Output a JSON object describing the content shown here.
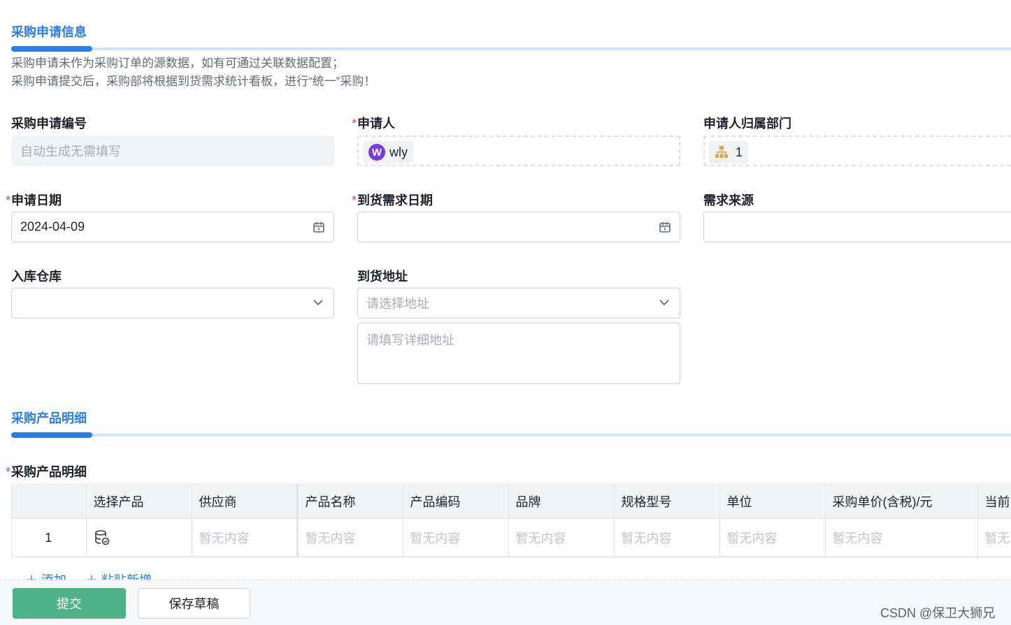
{
  "section1": {
    "title": "采购申请信息",
    "notes": [
      "采购申请未作为采购订单的源数据，如有可通过关联数据配置；",
      "采购申请提交后，采购部将根据到货需求统计看板，进行“统一”采购！"
    ]
  },
  "fields": {
    "request_no": {
      "label": "采购申请编号",
      "placeholder": "自动生成无需填写"
    },
    "applicant": {
      "required_mark": "*",
      "label": "申请人",
      "avatar_letter": "W",
      "value": "wly"
    },
    "department": {
      "label": "申请人归属部门",
      "icon": "org-chart-icon",
      "value": "1"
    },
    "apply_date": {
      "required_mark": "*",
      "label": "申请日期",
      "value": "2024-04-09",
      "icon": "calendar-icon"
    },
    "arrival_date": {
      "required_mark": "*",
      "label": "到货需求日期",
      "value": "",
      "icon": "calendar-icon"
    },
    "demand_source": {
      "label": "需求来源",
      "value": "",
      "icon": "chevron-down-icon"
    },
    "warehouse": {
      "label": "入库仓库",
      "value": "",
      "icon": "chevron-down-icon"
    },
    "address": {
      "label": "到货地址",
      "select_placeholder": "请选择地址",
      "detail_placeholder": "请填写详细地址"
    }
  },
  "section2": {
    "title": "采购产品明细"
  },
  "detail_table": {
    "required_mark": "*",
    "label": "采购产品明细",
    "columns": [
      "",
      "选择产品",
      "供应商",
      "产品名称",
      "产品编码",
      "品牌",
      "规格型号",
      "单位",
      "采购单价(含税)/元",
      "当前"
    ],
    "row": {
      "index": "1",
      "product_icon": "database-icon",
      "cells": [
        "暂无内容",
        "暂无内容",
        "暂无内容",
        "暂无内容",
        "暂无内容",
        "暂无内容",
        "暂无内容",
        "暂无"
      ]
    }
  },
  "table_actions": {
    "add": "添加",
    "paste_add": "粘贴新增"
  },
  "footer": {
    "submit": "提交",
    "save_draft": "保存草稿"
  },
  "watermark": "CSDN @保卫大狮兄",
  "colors": {
    "accent": "#2b7de9",
    "submit": "#4fb38a",
    "required": "#e5484d",
    "avatar": "#7a3bde",
    "org_icon": "#e8a33d"
  }
}
